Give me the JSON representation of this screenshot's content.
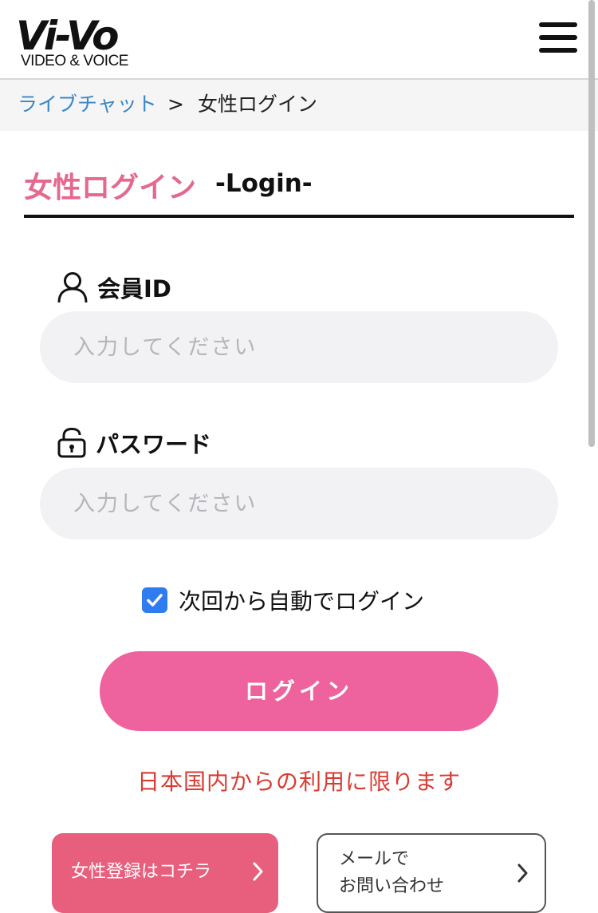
{
  "header": {
    "logo_text": "Vi-Vo",
    "logo_subtitle": "VIDEO & VOICE",
    "menu_icon": "hamburger-menu-icon"
  },
  "breadcrumb": {
    "parent": "ライブチャット",
    "separator": ">",
    "current": "女性ログイン"
  },
  "title": {
    "main": "女性ログイン",
    "sub": "-Login-"
  },
  "form": {
    "member_id": {
      "icon": "user-icon",
      "label": "会員ID",
      "placeholder": "入力してください",
      "value": ""
    },
    "password": {
      "icon": "lock-icon",
      "label": "パスワード",
      "placeholder": "入力してください",
      "value": ""
    },
    "remember": {
      "label": "次回から自動でログイン",
      "checked": true
    },
    "login_button": "ログイン"
  },
  "notice": "日本国内からの利用に限ります",
  "bottom_buttons": {
    "register": "女性登録はコチラ",
    "mail_line1": "メールで",
    "mail_line2": "お問い合わせ"
  },
  "colors": {
    "accent_pink": "#ee629d",
    "title_pink": "#e5698e",
    "register_pink": "#e85e7d",
    "link_blue": "#3a86c8",
    "notice_red": "#d93b32",
    "checkbox_blue": "#2f7bf0"
  }
}
